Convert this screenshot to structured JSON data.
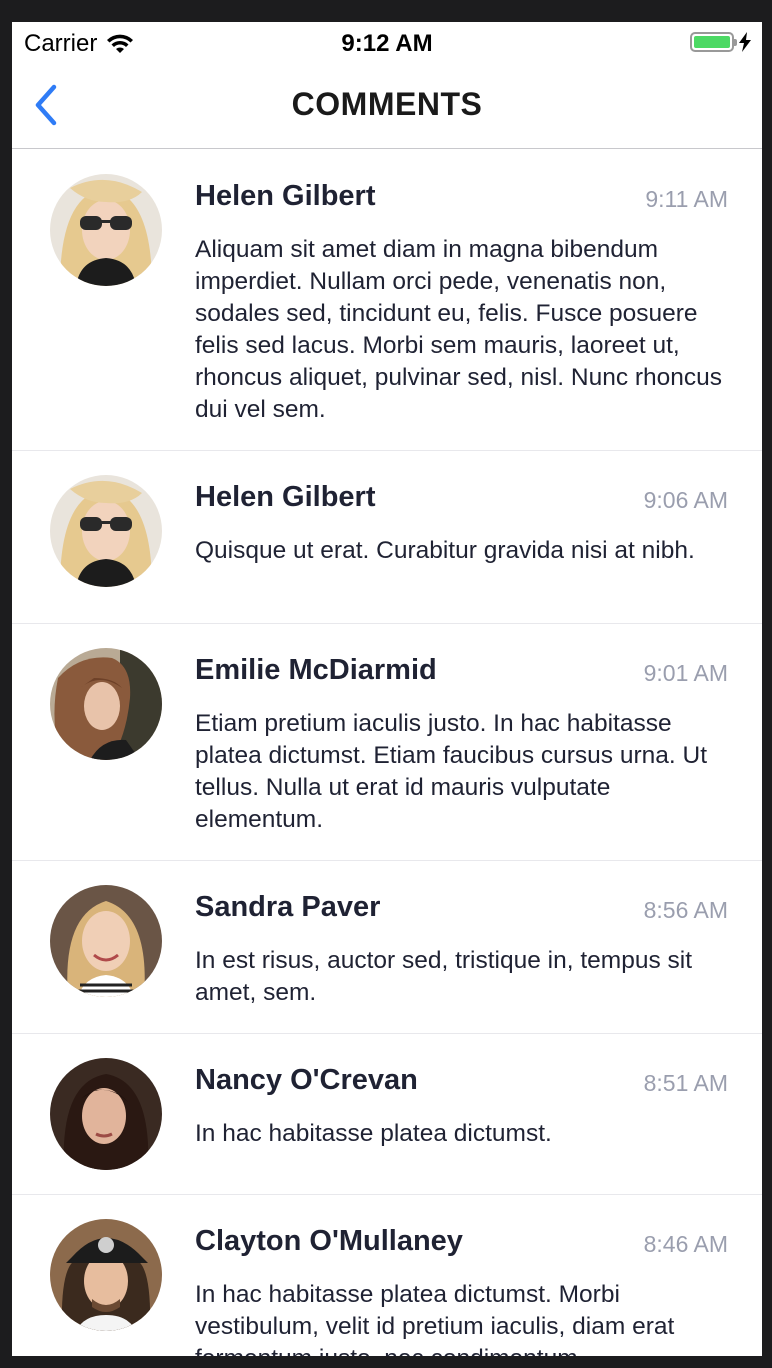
{
  "status_bar": {
    "carrier": "Carrier",
    "time": "9:12 AM",
    "battery_level": 1.0,
    "battery_color": "#4cd964"
  },
  "nav": {
    "title": "COMMENTS",
    "back_icon": "chevron-left-icon",
    "accent_color": "#2f7cf6"
  },
  "comments": [
    {
      "name": "Helen Gilbert",
      "time": "9:11 AM",
      "text": "Aliquam sit amet diam in magna bibendum imperdiet. Nullam orci pede, venenatis non, sodales sed, tincidunt eu, felis. Fusce posuere felis sed lacus. Morbi sem mauris, laoreet ut, rhoncus aliquet, pulvinar sed, nisl. Nunc rhoncus dui vel sem."
    },
    {
      "name": "Helen Gilbert",
      "time": "9:06 AM",
      "text": "Quisque ut erat. Curabitur gravida nisi at nibh."
    },
    {
      "name": "Emilie McDiarmid",
      "time": "9:01 AM",
      "text": "Etiam pretium iaculis justo. In hac habitasse platea dictumst. Etiam faucibus cursus urna. Ut tellus. Nulla ut erat id mauris vulputate elementum."
    },
    {
      "name": "Sandra Paver",
      "time": "8:56 AM",
      "text": "In est risus, auctor sed, tristique in, tempus sit amet, sem."
    },
    {
      "name": "Nancy O'Crevan",
      "time": "8:51 AM",
      "text": "In hac habitasse platea dictumst."
    },
    {
      "name": "Clayton O'Mullaney",
      "time": "8:46 AM",
      "text": "In hac habitasse platea dictumst. Morbi vestibulum, velit id pretium iaculis, diam erat fermentum justo, nec condimentum"
    }
  ]
}
